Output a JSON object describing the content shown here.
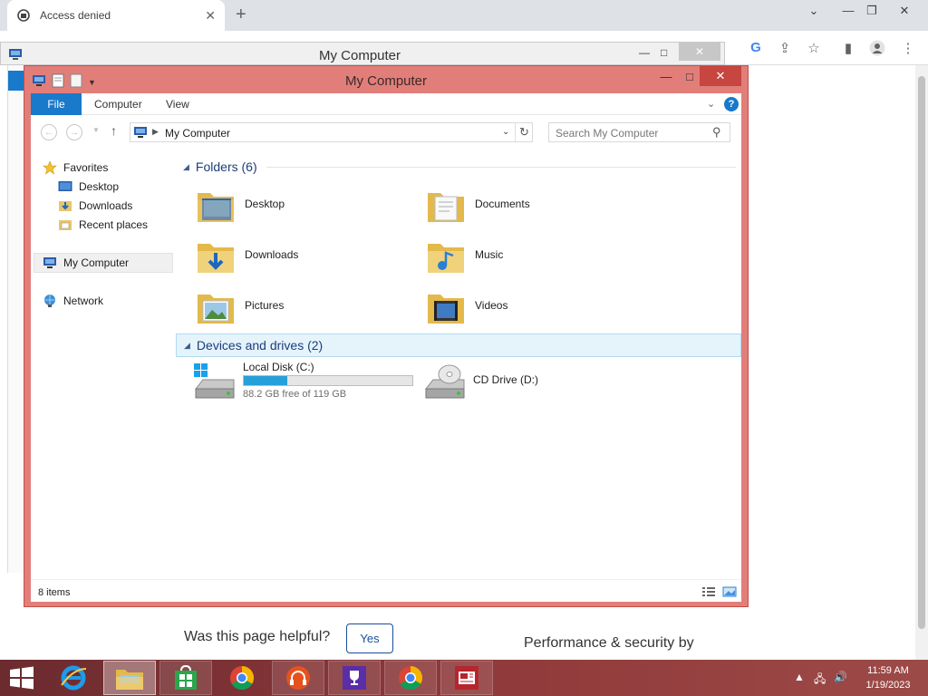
{
  "browser": {
    "tab_title": "Access denied",
    "page": {
      "helpful_question": "Was this page helpful?",
      "yes_label": "Yes",
      "performance_text": "Performance & security by"
    }
  },
  "back_window": {
    "title": "My Computer"
  },
  "explorer": {
    "title": "My Computer",
    "ribbon_tabs": [
      "File",
      "Computer",
      "View"
    ],
    "address": "My Computer",
    "search_placeholder": "Search My Computer",
    "nav": {
      "favorites": "Favorites",
      "desktop": "Desktop",
      "downloads": "Downloads",
      "recent": "Recent places",
      "my_computer": "My Computer",
      "network": "Network"
    },
    "folders_header": "Folders (6)",
    "folders": [
      "Desktop",
      "Documents",
      "Downloads",
      "Music",
      "Pictures",
      "Videos"
    ],
    "devices_header": "Devices and drives (2)",
    "drives": {
      "c_label": "Local Disk (C:)",
      "c_free_text": "88.2 GB free of 119 GB",
      "c_used_fraction": 0.26,
      "d_label": "CD Drive (D:)"
    },
    "status": "8 items"
  },
  "taskbar": {
    "clock_time": "11:59 AM",
    "clock_date": "1/19/2023"
  },
  "colors": {
    "explorer_frame": "#e27e79",
    "accent_blue": "#1979ca",
    "taskbar": "#913a3b"
  }
}
